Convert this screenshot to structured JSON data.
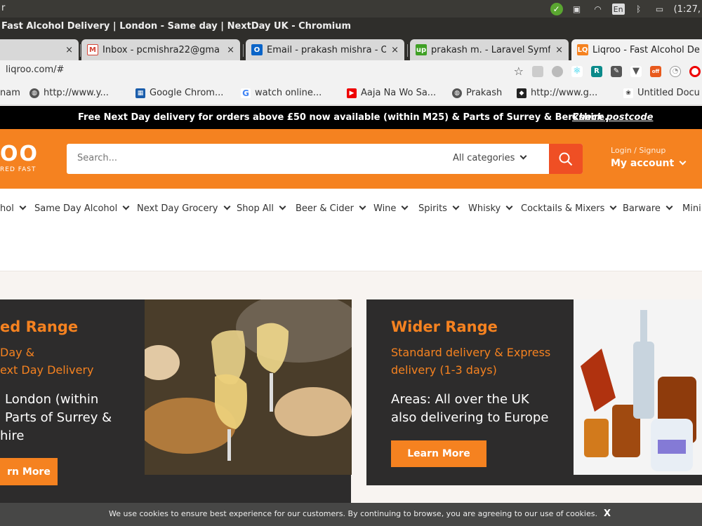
{
  "os": {
    "left_text": "r",
    "time": "(1:27,",
    "lang": "En"
  },
  "window": {
    "title": "Fast Alcohol Delivery | London - Same day | NextDay UK - Chromium"
  },
  "tabs": [
    {
      "label": "",
      "favicon": "",
      "close": "×"
    },
    {
      "label": "Inbox - pcmishra22@gma",
      "favicon": "gmail-icon",
      "close": "×"
    },
    {
      "label": "Email - prakash mishra - O",
      "favicon": "outlook-icon",
      "close": "×"
    },
    {
      "label": "prakash m. - Laravel Symfo",
      "favicon": "upwork-icon",
      "close": "×"
    },
    {
      "label": "Liqroo - Fast Alcohol De",
      "favicon": "liqroo-icon",
      "close": ""
    }
  ],
  "address": {
    "url": "liqroo.com/#"
  },
  "bookmarks": [
    {
      "label": "nam",
      "icon": ""
    },
    {
      "label": "http://www.y...",
      "icon": "globe-icon"
    },
    {
      "label": "Google Chrom...",
      "icon": "grid-icon"
    },
    {
      "label": "watch online...",
      "icon": "google-icon"
    },
    {
      "label": "Aaja Na Wo Sa...",
      "icon": "youtube-icon"
    },
    {
      "label": "Prakash",
      "icon": "globe-icon"
    },
    {
      "label": "http://www.g...",
      "icon": "bookmark-icon"
    },
    {
      "label": "Untitled Docu",
      "icon": "doc-icon"
    }
  ],
  "promo": {
    "text": "Free Next Day delivery for orders above £50 now available (within M25) & Parts of Surrey & Berkshire.",
    "link": "Check postcode"
  },
  "header": {
    "logo_big": "OO",
    "logo_small": "RED FAST",
    "search_placeholder": "Search...",
    "categories": "All categories",
    "login": "Login / Signup",
    "account": "My account"
  },
  "nav": [
    "hol",
    "Same Day Alcohol",
    "Next Day Grocery",
    "Shop All",
    "Beer & Cider",
    "Wine",
    "Spirits",
    "Whisky",
    "Cocktails & Mixers",
    "Barware",
    "Mini"
  ],
  "cards": {
    "left": {
      "title": "ed Range",
      "sub1": "Day &",
      "sub2": "ext Day Delivery",
      "area1": "London (within",
      "area2": "Parts of Surrey &",
      "area3": "hire",
      "button": "rn More"
    },
    "right": {
      "title": "Wider Range",
      "sub1": "Standard delivery & Express",
      "sub2": "delivery (1-3 days)",
      "area1": "Areas: All over the UK",
      "area2": "also delivering to Europe",
      "button": "Learn More"
    }
  },
  "cookie": {
    "text": "We use cookies to ensure best experience for our customers. By continuing to browse, you are agreeing to our use of cookies.",
    "close": "X"
  },
  "colors": {
    "brand": "#f58220",
    "search_button": "#ef4f24",
    "card_bg": "#2d2c2c"
  }
}
